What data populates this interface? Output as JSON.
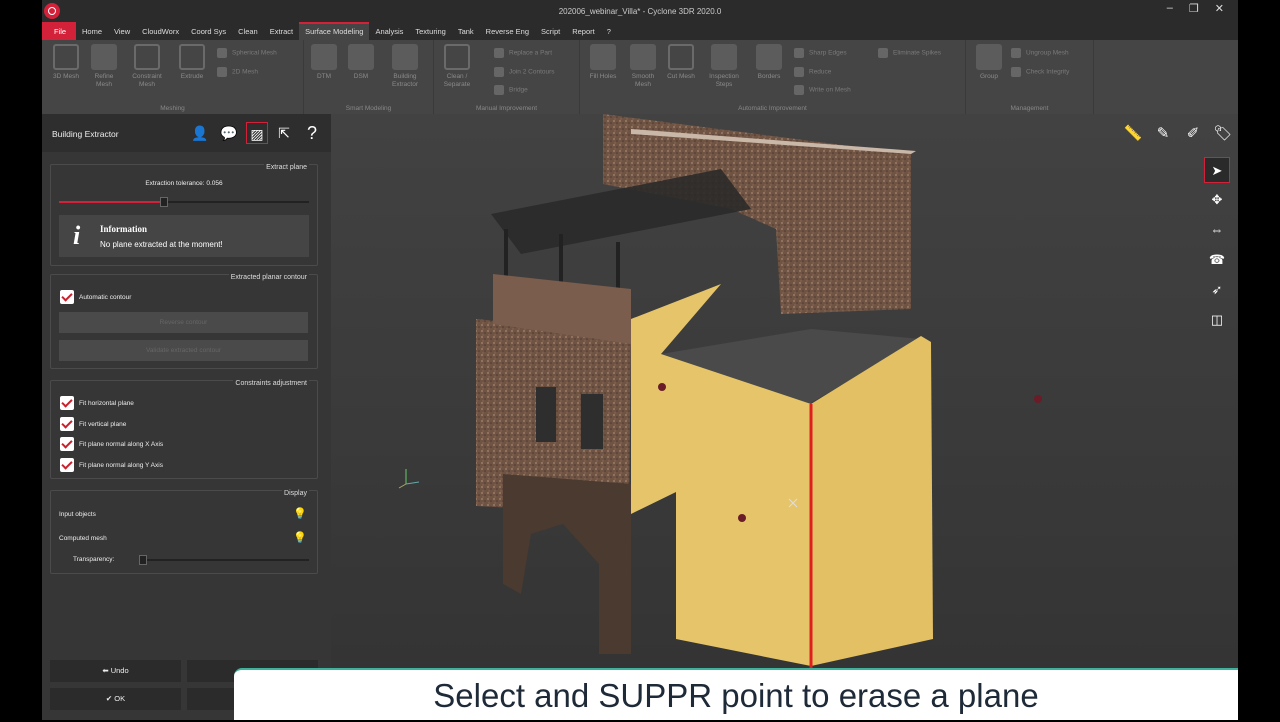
{
  "window": {
    "title": "202006_webinar_Villa* - Cyclone 3DR 2020.0"
  },
  "menu": {
    "file": "File",
    "tabs": [
      "Home",
      "View",
      "CloudWorx",
      "Coord Sys",
      "Clean",
      "Extract",
      "Surface Modeling",
      "Analysis",
      "Texturing",
      "Tank",
      "Reverse Eng",
      "Script",
      "Report",
      "?"
    ],
    "active": "Surface Modeling"
  },
  "ribbon": {
    "meshing": {
      "label": "Meshing",
      "mesh3d": "3D Mesh",
      "refine": "Refine Mesh",
      "constraint": "Constraint Mesh",
      "extrude": "Extrude",
      "spherical": "Spherical Mesh",
      "mesh2d": "2D Mesh"
    },
    "smart": {
      "label": "Smart Modeling",
      "dtm": "DTM",
      "dsm": "DSM",
      "building": "Building Extractor"
    },
    "manual": {
      "label": "Manual Improvement",
      "clean": "Clean / Separate",
      "replace": "Replace a Part",
      "join": "Join 2 Contours",
      "bridge": "Bridge"
    },
    "automatic": {
      "label": "Automatic Improvement",
      "fill": "Fill Holes",
      "smooth": "Smooth Mesh",
      "cut": "Cut Mesh",
      "inspection": "Inspection Steps",
      "borders": "Borders",
      "sharp": "Sharp Edges",
      "reduce": "Reduce",
      "write": "Write on Mesh",
      "spikes": "Eliminate Spikes"
    },
    "management": {
      "label": "Management",
      "group": "Group",
      "ungroup": "Ungroup Mesh",
      "integrity": "Check Integrity"
    }
  },
  "panel": {
    "title": "Building Extractor",
    "extract_plane": {
      "title": "Extract plane",
      "tolerance_label": "Extraction tolerance: 0.056",
      "tolerance_value": 0.42,
      "info_title": "Information",
      "info_text": "No plane extracted at the moment!"
    },
    "contour": {
      "title": "Extracted planar contour",
      "automatic": "Automatic contour",
      "btn1": "Reverse contour",
      "btn2": "Validate extracted contour"
    },
    "constraints": {
      "title": "Constraints adjustment",
      "items": [
        "Fit horizontal plane",
        "Fit vertical plane",
        "Fit plane normal along X Axis",
        "Fit plane normal along Y Axis"
      ]
    },
    "display": {
      "title": "Display",
      "input": "Input objects",
      "computed": "Computed mesh",
      "transparency": "Transparency:"
    },
    "buttons": {
      "undo": "Undo",
      "ok": "OK"
    }
  },
  "caption": "Select and SUPPR point to erase a plane",
  "colors": {
    "accent": "#d3213a",
    "facade": "#e6c56a",
    "stone": "#7a5a48"
  }
}
